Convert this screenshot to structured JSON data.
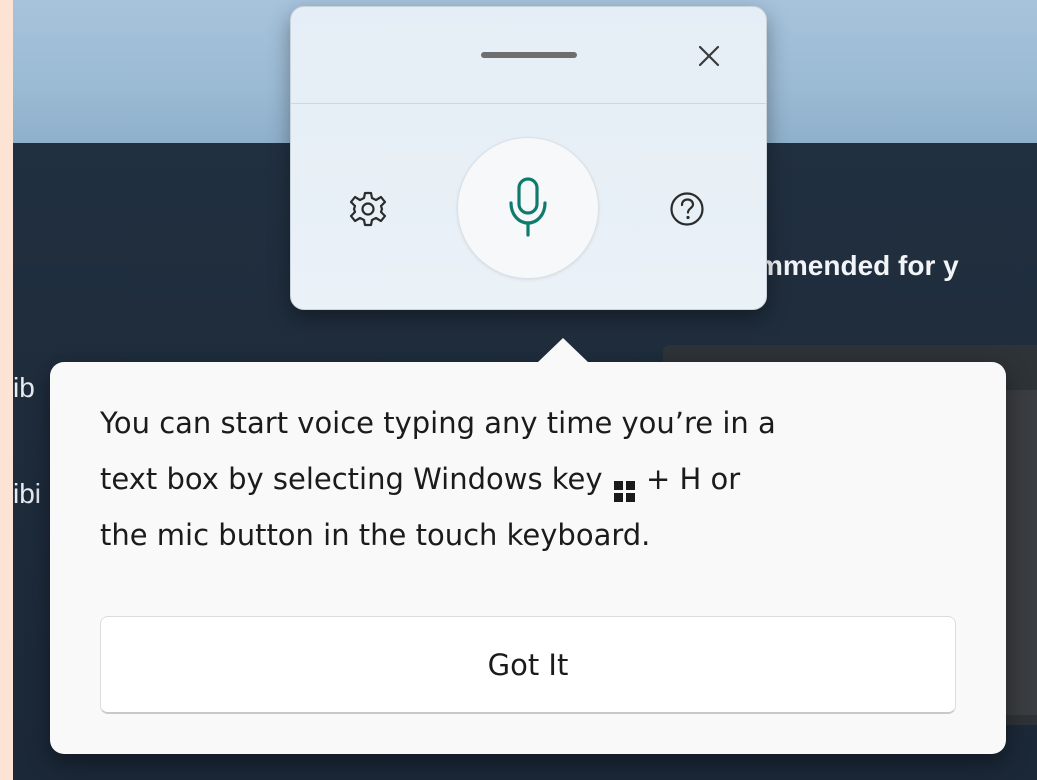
{
  "background": {
    "section_heading": "mmended for y",
    "left_fragment_1": "ib",
    "left_fragment_2": "ibi"
  },
  "voice_typing_panel": {
    "close_icon": "close-icon",
    "settings_icon": "gear-icon",
    "mic_icon": "microphone-icon",
    "help_icon": "help-circle-icon",
    "mic_color": "#0f7b6c"
  },
  "teaching_tip": {
    "line_1": "You can start voice typing any time you’re in a",
    "line_2_before_key": "text box by selecting Windows key",
    "line_2_after_key": "+ H or",
    "line_3": "the mic button in the touch keyboard.",
    "windows_key_icon": "windows-logo-icon",
    "button_label": "Got It"
  }
}
